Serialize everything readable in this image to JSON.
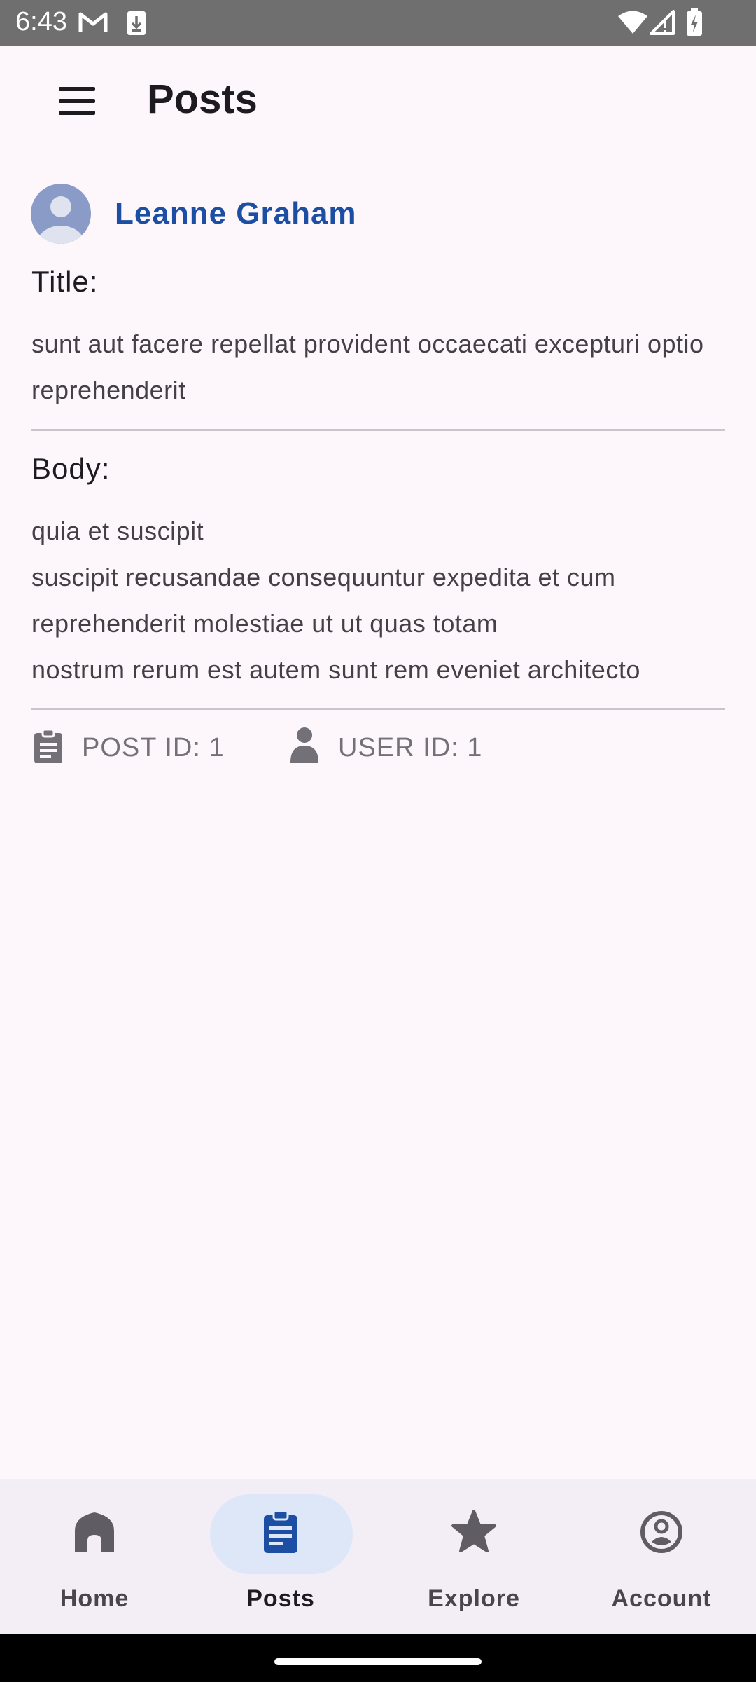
{
  "status_bar": {
    "time": "6:43",
    "icons": [
      "gmail-icon",
      "download-icon",
      "wifi-icon",
      "signal-icon",
      "battery-charging-icon"
    ]
  },
  "app_bar": {
    "menu_icon": "hamburger-menu-icon",
    "title": "Posts"
  },
  "post": {
    "author_name": "Leanne Graham",
    "title_label": "Title:",
    "title": "sunt aut facere repellat provident occaecati excepturi optio reprehenderit",
    "body_label": "Body:",
    "body_lines": [
      "quia et suscipit",
      "suscipit recusandae consequuntur expedita et cum",
      "reprehenderit molestiae ut ut quas totam",
      "nostrum rerum est autem sunt rem eveniet architecto"
    ],
    "post_id_label": "POST ID: 1",
    "user_id_label": "USER ID: 1"
  },
  "bottom_nav": {
    "active": "Posts",
    "items": [
      {
        "label": "Home",
        "icon": "home-icon"
      },
      {
        "label": "Posts",
        "icon": "posts-icon"
      },
      {
        "label": "Explore",
        "icon": "star-icon"
      },
      {
        "label": "Account",
        "icon": "account-icon"
      }
    ]
  },
  "colors": {
    "accent": "#1c4fa4",
    "background": "#fdf7fb",
    "nav_active_pill": "#dde7f7",
    "status_bar": "#6f6f6f"
  }
}
